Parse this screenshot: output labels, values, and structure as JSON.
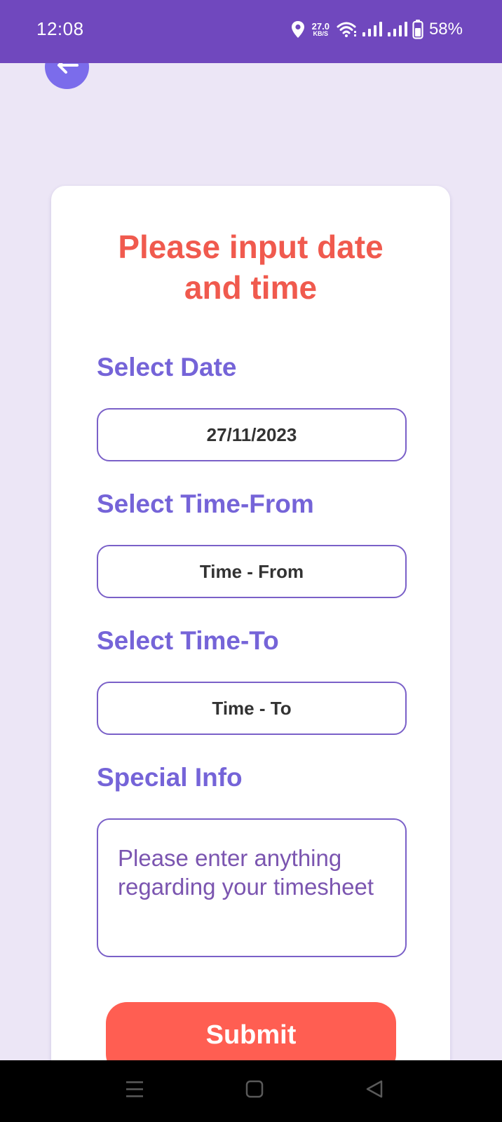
{
  "status_bar": {
    "time": "12:08",
    "net_speed_value": "27.0",
    "net_speed_unit": "KB/S",
    "battery_percent": "58%"
  },
  "form": {
    "title": "Please input date and time",
    "date_label": "Select Date",
    "date_value": "27/11/2023",
    "time_from_label": "Select Time-From",
    "time_from_value": "Time - From",
    "time_to_label": "Select Time-To",
    "time_to_value": "Time - To",
    "special_info_label": "Special Info",
    "special_info_placeholder": "Please enter anything regarding your timesheet",
    "submit_label": "Submit"
  },
  "colors": {
    "status_bar": "#7048BE",
    "background": "#ECE6F6",
    "accent": "#7564D8",
    "title": "#F05A4E",
    "submit": "#FF5E52"
  },
  "icons": {
    "back": "arrow-left-icon",
    "location": "location-pin-icon",
    "wifi": "wifi-icon",
    "signal": "signal-icon",
    "battery": "battery-icon",
    "nav_menu": "menu-icon",
    "nav_home": "home-square-icon",
    "nav_back": "back-triangle-icon"
  }
}
